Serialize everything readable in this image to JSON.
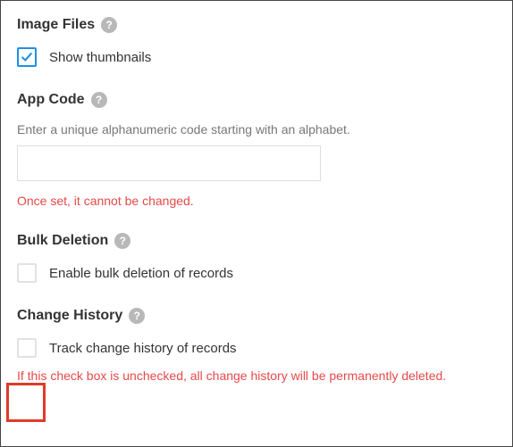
{
  "imageFiles": {
    "title": "Image Files",
    "showThumbnailsLabel": "Show thumbnails",
    "showThumbnailsChecked": true
  },
  "appCode": {
    "title": "App Code",
    "description": "Enter a unique alphanumeric code starting with an alphabet.",
    "value": "",
    "warning": "Once set, it cannot be changed."
  },
  "bulkDeletion": {
    "title": "Bulk Deletion",
    "enableLabel": "Enable bulk deletion of records",
    "enableChecked": false
  },
  "changeHistory": {
    "title": "Change History",
    "trackLabel": "Track change history of records",
    "trackChecked": false,
    "warning": "If this check box is unchecked, all change history will be permanently deleted."
  },
  "helpGlyph": "?"
}
